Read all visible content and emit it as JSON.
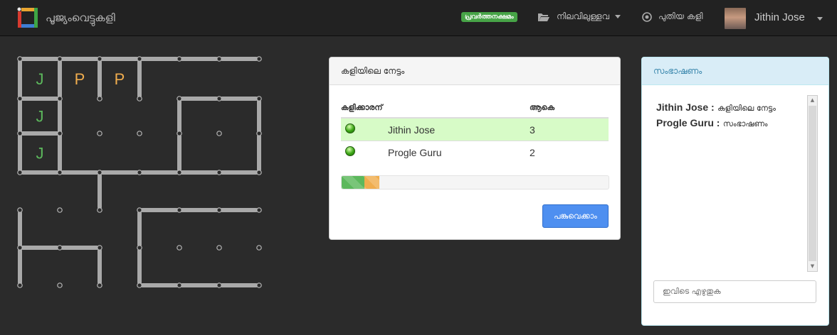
{
  "header": {
    "brand": "പൂജ്യംവെട്ടുകളി",
    "status_badge": "പ്രവർത്തനക്ഷമം",
    "nav_current": "നിലവിലുള്ളവ",
    "nav_new_game": "പുതിയ കളി",
    "user_name": "Jithin Jose"
  },
  "board": {
    "cells": [
      {
        "col": 0,
        "row": 0,
        "letter": "J",
        "color": "#5cb85c"
      },
      {
        "col": 1,
        "row": 0,
        "letter": "P",
        "color": "#f0ad4e"
      },
      {
        "col": 2,
        "row": 0,
        "letter": "P",
        "color": "#f0ad4e"
      },
      {
        "col": 0,
        "row": 1,
        "letter": "J",
        "color": "#5cb85c"
      },
      {
        "col": 0,
        "row": 2,
        "letter": "J",
        "color": "#5cb85c"
      }
    ]
  },
  "scores": {
    "title": "കളിയിലെ നേട്ടം",
    "col_player": "കളിക്കാരന്",
    "col_total": "ആകെ",
    "rows": [
      {
        "name": "Jithin Jose",
        "score": "3",
        "active": true
      },
      {
        "name": "Progle Guru",
        "score": "2",
        "active": false
      }
    ],
    "progress": [
      {
        "fraction": 0.085,
        "color": "#5cb85c"
      },
      {
        "fraction": 0.057,
        "color": "#f0ad4e"
      }
    ],
    "share_button": "പങ്കുവെക്കാം"
  },
  "chat": {
    "title": "സംഭാഷണം",
    "messages": [
      {
        "sender": "Jithin Jose :",
        "text": "കളിയിലെ നേട്ടം"
      },
      {
        "sender": "Progle Guru :",
        "text": "സംഭാഷണം"
      }
    ],
    "input_placeholder": "ഇവിടെ എഴുതുക"
  },
  "colors": {
    "green": "#5cb85c",
    "orange": "#f0ad4e",
    "accent": "#4e8ff0"
  }
}
